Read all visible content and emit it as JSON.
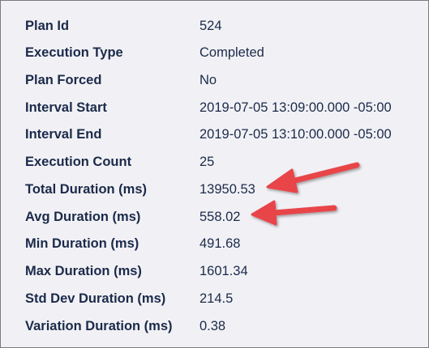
{
  "tooltip": {
    "rows": [
      {
        "label": "Plan Id",
        "value": "524"
      },
      {
        "label": "Execution Type",
        "value": "Completed"
      },
      {
        "label": "Plan Forced",
        "value": "No"
      },
      {
        "label": "Interval Start",
        "value": "2019-07-05 13:09:00.000 -05:00"
      },
      {
        "label": "Interval End",
        "value": "2019-07-05 13:10:00.000 -05:00"
      },
      {
        "label": "Execution Count",
        "value": "25"
      },
      {
        "label": "Total Duration (ms)",
        "value": "13950.53"
      },
      {
        "label": "Avg Duration (ms)",
        "value": "558.02"
      },
      {
        "label": "Min Duration (ms)",
        "value": "491.68"
      },
      {
        "label": "Max Duration (ms)",
        "value": "1601.34"
      },
      {
        "label": "Std Dev Duration (ms)",
        "value": "214.5"
      },
      {
        "label": "Variation Duration (ms)",
        "value": "0.38"
      }
    ]
  },
  "colors": {
    "background": "#f1f1f5",
    "text": "#1b2a4a",
    "border": "#7a7a7a",
    "arrow": "#e8444a"
  }
}
